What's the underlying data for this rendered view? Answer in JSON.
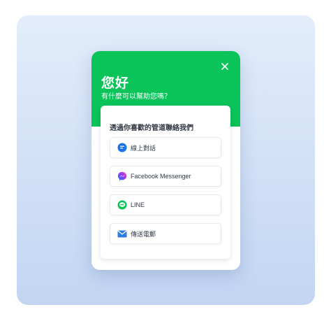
{
  "widget": {
    "greeting": "您好",
    "subtitle": "有什麼可以幫助您嗎？",
    "header_color": "#0ac45a",
    "close_icon": "close-icon"
  },
  "card": {
    "title": "透過你喜歡的管道聯絡我們",
    "channels": [
      {
        "label": "線上對話",
        "icon": "live-chat-icon",
        "color": "#1a73e8"
      },
      {
        "label": "Facebook Messenger",
        "icon": "messenger-icon",
        "color": "#a334fa"
      },
      {
        "label": "LINE",
        "icon": "line-icon",
        "color": "#06c755"
      },
      {
        "label": "傳送電郵",
        "icon": "email-icon",
        "color": "#2f7de1"
      }
    ]
  }
}
